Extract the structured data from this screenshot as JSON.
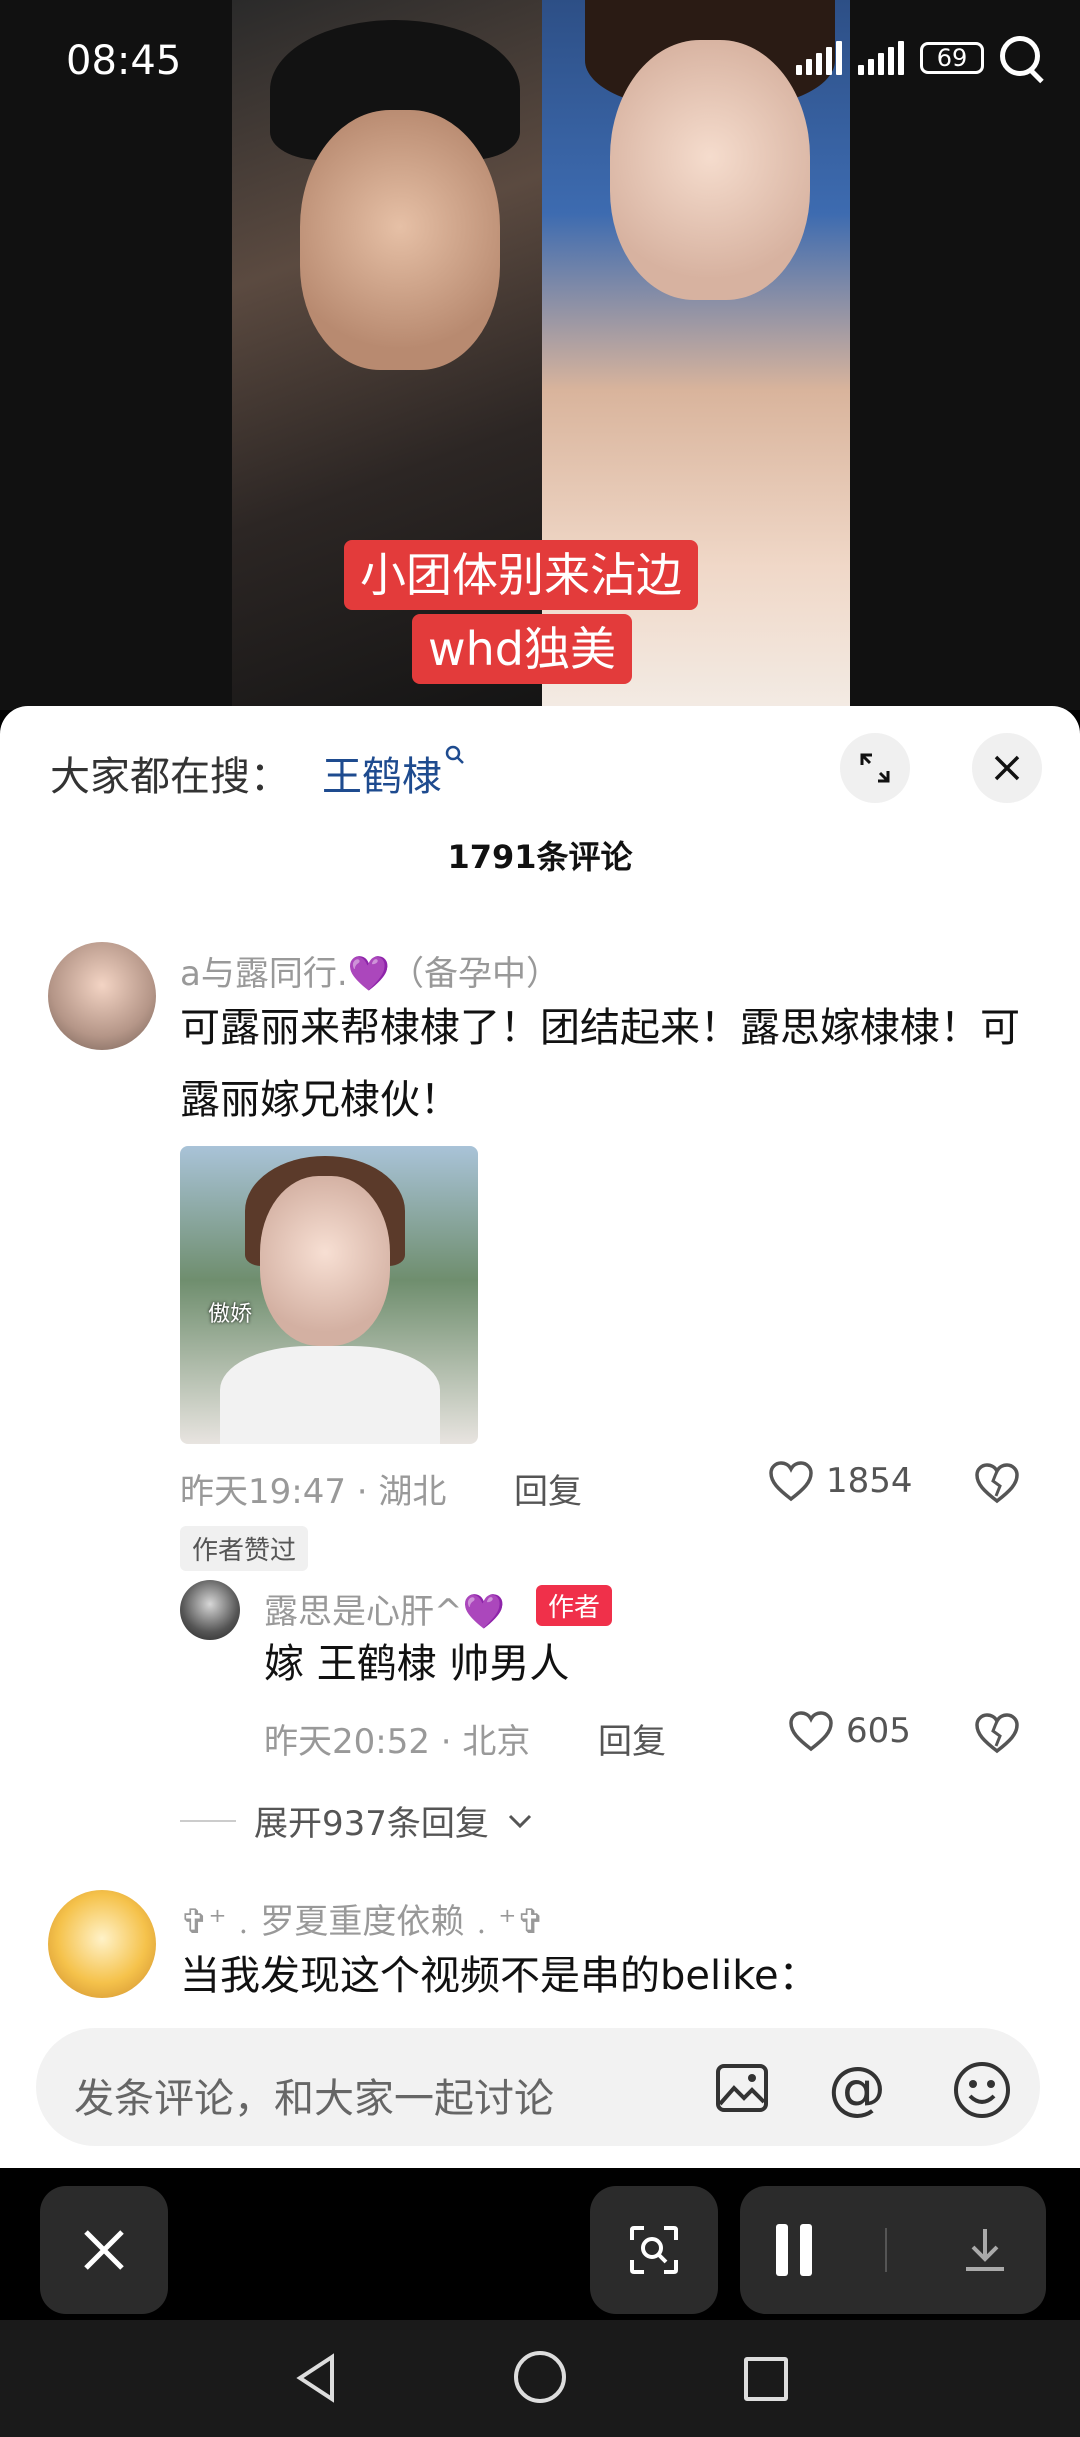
{
  "status_bar": {
    "time": "08:45",
    "battery": "69"
  },
  "video": {
    "caption_line1": "小团体别来沾边",
    "caption_line2": "whd独美"
  },
  "search_suggest": {
    "prefix": "大家都在搜：",
    "term": "王鹤棣"
  },
  "comments_header": {
    "count": "1791条评论"
  },
  "comments": [
    {
      "username": "a与露同行.",
      "user_suffix": "（备孕中）",
      "text": "可露丽来帮棣棣了！团结起来！露思嫁棣棣！可露丽嫁兄棣伙！",
      "image_sticker_text": "傲娇",
      "time_location": "昨天19:47 · 湖北",
      "reply_label": "回复",
      "likes": "1854",
      "author_liked": "作者赞过",
      "reply": {
        "username": "露思是心肝^",
        "badge": "作者",
        "text": "嫁 王鹤棣 帅男人",
        "time_location": "昨天20:52 · 北京",
        "reply_label": "回复",
        "likes": "605"
      },
      "expand_label": "展开937条回复"
    },
    {
      "username": "✞⁺﹒罗夏重度依赖﹒⁺✞",
      "text": "当我发现这个视频不是串的belike："
    }
  ],
  "input": {
    "placeholder": "发条评论，和大家一起讨论"
  }
}
